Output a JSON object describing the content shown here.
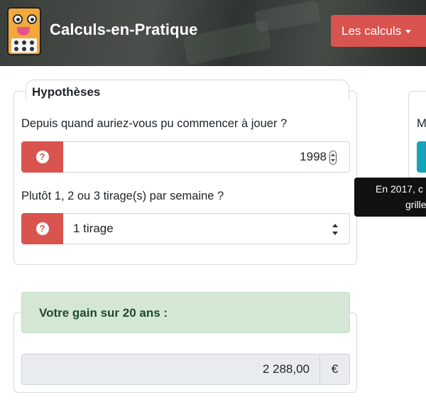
{
  "header": {
    "brand": "Calculs-en-Pratique",
    "menu_button": "Les calculs"
  },
  "hypotheses": {
    "title": "Hypothèses",
    "start_question": "Depuis quand auriez-vous pu commencer à jouer ?",
    "start_value": "1998",
    "draws_question": "Plutôt 1, 2 ou 3 tirage(s) par semaine ?",
    "draws_selected": "1 tirage"
  },
  "right_panel": {
    "partial_label": "M"
  },
  "tooltip": {
    "line1": "En 2017, c",
    "line2": "grille"
  },
  "result": {
    "title": "Votre gain sur 20 ans :",
    "value": "2 288,00",
    "unit": "€"
  },
  "colors": {
    "danger": "#d9534f",
    "success_bg": "#d4e7d5",
    "info": "#17a2b8"
  },
  "icons": {
    "help": "question-circle-icon",
    "menu_caret": "caret-down-icon"
  }
}
